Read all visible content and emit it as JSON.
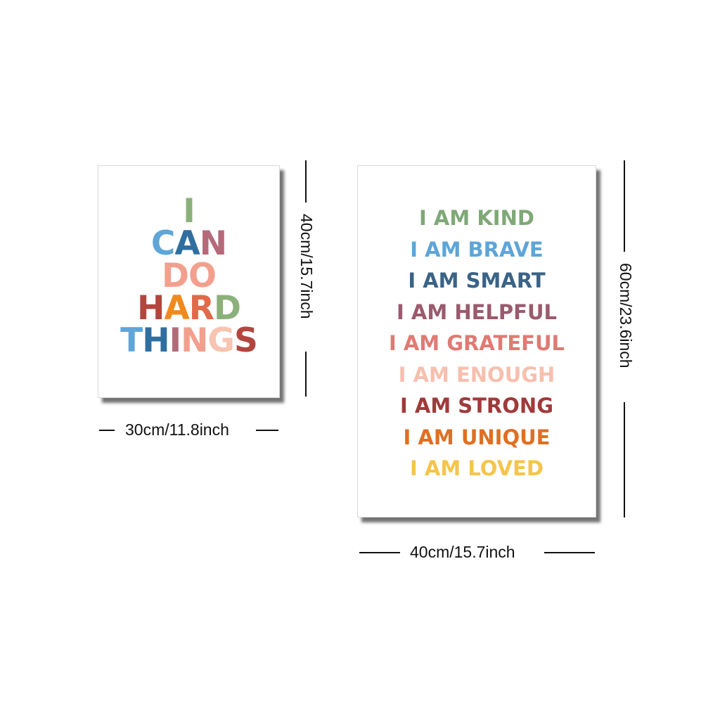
{
  "small_poster": {
    "lines": [
      {
        "letters": [
          {
            "ch": "I",
            "color": "#8cb07a"
          }
        ]
      },
      {
        "letters": [
          {
            "ch": "C",
            "color": "#5ea5d8"
          },
          {
            "ch": "A",
            "color": "#2f6fa0"
          },
          {
            "ch": "N",
            "color": "#b56a79"
          }
        ]
      },
      {
        "letters": [
          {
            "ch": "D",
            "color": "#f2a08e"
          },
          {
            "ch": "O",
            "color": "#f2a08e"
          }
        ]
      },
      {
        "letters": [
          {
            "ch": "H",
            "color": "#b2463f"
          },
          {
            "ch": "A",
            "color": "#f08a1c"
          },
          {
            "ch": "R",
            "color": "#e06a4a"
          },
          {
            "ch": "D",
            "color": "#8cb07a"
          }
        ]
      },
      {
        "letters": [
          {
            "ch": "T",
            "color": "#5ea5d8"
          },
          {
            "ch": "H",
            "color": "#2f6fa0"
          },
          {
            "ch": "I",
            "color": "#b56a79"
          },
          {
            "ch": "N",
            "color": "#f2a08e"
          },
          {
            "ch": "G",
            "color": "#f7c4b0"
          },
          {
            "ch": "S",
            "color": "#b2463f"
          }
        ]
      }
    ],
    "width_label": "30cm/11.8inch",
    "height_label": "40cm/15.7inch"
  },
  "large_poster": {
    "lines": [
      {
        "text": "I AM KIND",
        "color": "#7fa877"
      },
      {
        "text": "I AM BRAVE",
        "color": "#5ea5d8"
      },
      {
        "text": "I AM SMART",
        "color": "#3a6386"
      },
      {
        "text": "I AM HELPFUL",
        "color": "#9b5a6e"
      },
      {
        "text": "I AM GRATEFUL",
        "color": "#e07a73"
      },
      {
        "text": "I AM ENOUGH",
        "color": "#f7bfae"
      },
      {
        "text": "I AM STRONG",
        "color": "#a03a3a"
      },
      {
        "text": "I AM UNIQUE",
        "color": "#e06f22"
      },
      {
        "text": "I AM LOVED",
        "color": "#f5c54a"
      }
    ],
    "width_label": "40cm/15.7inch",
    "height_label": "60cm/23.6inch"
  }
}
